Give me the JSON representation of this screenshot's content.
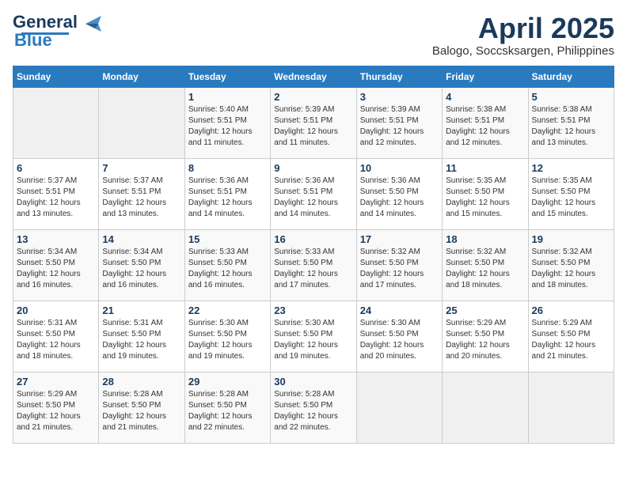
{
  "header": {
    "logo_line1": "General",
    "logo_line2": "Blue",
    "month_title": "April 2025",
    "subtitle": "Balogo, Soccsksargen, Philippines"
  },
  "days_of_week": [
    "Sunday",
    "Monday",
    "Tuesday",
    "Wednesday",
    "Thursday",
    "Friday",
    "Saturday"
  ],
  "weeks": [
    [
      {
        "day": "",
        "info": ""
      },
      {
        "day": "",
        "info": ""
      },
      {
        "day": "1",
        "info": "Sunrise: 5:40 AM\nSunset: 5:51 PM\nDaylight: 12 hours and 11 minutes."
      },
      {
        "day": "2",
        "info": "Sunrise: 5:39 AM\nSunset: 5:51 PM\nDaylight: 12 hours and 11 minutes."
      },
      {
        "day": "3",
        "info": "Sunrise: 5:39 AM\nSunset: 5:51 PM\nDaylight: 12 hours and 12 minutes."
      },
      {
        "day": "4",
        "info": "Sunrise: 5:38 AM\nSunset: 5:51 PM\nDaylight: 12 hours and 12 minutes."
      },
      {
        "day": "5",
        "info": "Sunrise: 5:38 AM\nSunset: 5:51 PM\nDaylight: 12 hours and 13 minutes."
      }
    ],
    [
      {
        "day": "6",
        "info": "Sunrise: 5:37 AM\nSunset: 5:51 PM\nDaylight: 12 hours and 13 minutes."
      },
      {
        "day": "7",
        "info": "Sunrise: 5:37 AM\nSunset: 5:51 PM\nDaylight: 12 hours and 13 minutes."
      },
      {
        "day": "8",
        "info": "Sunrise: 5:36 AM\nSunset: 5:51 PM\nDaylight: 12 hours and 14 minutes."
      },
      {
        "day": "9",
        "info": "Sunrise: 5:36 AM\nSunset: 5:51 PM\nDaylight: 12 hours and 14 minutes."
      },
      {
        "day": "10",
        "info": "Sunrise: 5:36 AM\nSunset: 5:50 PM\nDaylight: 12 hours and 14 minutes."
      },
      {
        "day": "11",
        "info": "Sunrise: 5:35 AM\nSunset: 5:50 PM\nDaylight: 12 hours and 15 minutes."
      },
      {
        "day": "12",
        "info": "Sunrise: 5:35 AM\nSunset: 5:50 PM\nDaylight: 12 hours and 15 minutes."
      }
    ],
    [
      {
        "day": "13",
        "info": "Sunrise: 5:34 AM\nSunset: 5:50 PM\nDaylight: 12 hours and 16 minutes."
      },
      {
        "day": "14",
        "info": "Sunrise: 5:34 AM\nSunset: 5:50 PM\nDaylight: 12 hours and 16 minutes."
      },
      {
        "day": "15",
        "info": "Sunrise: 5:33 AM\nSunset: 5:50 PM\nDaylight: 12 hours and 16 minutes."
      },
      {
        "day": "16",
        "info": "Sunrise: 5:33 AM\nSunset: 5:50 PM\nDaylight: 12 hours and 17 minutes."
      },
      {
        "day": "17",
        "info": "Sunrise: 5:32 AM\nSunset: 5:50 PM\nDaylight: 12 hours and 17 minutes."
      },
      {
        "day": "18",
        "info": "Sunrise: 5:32 AM\nSunset: 5:50 PM\nDaylight: 12 hours and 18 minutes."
      },
      {
        "day": "19",
        "info": "Sunrise: 5:32 AM\nSunset: 5:50 PM\nDaylight: 12 hours and 18 minutes."
      }
    ],
    [
      {
        "day": "20",
        "info": "Sunrise: 5:31 AM\nSunset: 5:50 PM\nDaylight: 12 hours and 18 minutes."
      },
      {
        "day": "21",
        "info": "Sunrise: 5:31 AM\nSunset: 5:50 PM\nDaylight: 12 hours and 19 minutes."
      },
      {
        "day": "22",
        "info": "Sunrise: 5:30 AM\nSunset: 5:50 PM\nDaylight: 12 hours and 19 minutes."
      },
      {
        "day": "23",
        "info": "Sunrise: 5:30 AM\nSunset: 5:50 PM\nDaylight: 12 hours and 19 minutes."
      },
      {
        "day": "24",
        "info": "Sunrise: 5:30 AM\nSunset: 5:50 PM\nDaylight: 12 hours and 20 minutes."
      },
      {
        "day": "25",
        "info": "Sunrise: 5:29 AM\nSunset: 5:50 PM\nDaylight: 12 hours and 20 minutes."
      },
      {
        "day": "26",
        "info": "Sunrise: 5:29 AM\nSunset: 5:50 PM\nDaylight: 12 hours and 21 minutes."
      }
    ],
    [
      {
        "day": "27",
        "info": "Sunrise: 5:29 AM\nSunset: 5:50 PM\nDaylight: 12 hours and 21 minutes."
      },
      {
        "day": "28",
        "info": "Sunrise: 5:28 AM\nSunset: 5:50 PM\nDaylight: 12 hours and 21 minutes."
      },
      {
        "day": "29",
        "info": "Sunrise: 5:28 AM\nSunset: 5:50 PM\nDaylight: 12 hours and 22 minutes."
      },
      {
        "day": "30",
        "info": "Sunrise: 5:28 AM\nSunset: 5:50 PM\nDaylight: 12 hours and 22 minutes."
      },
      {
        "day": "",
        "info": ""
      },
      {
        "day": "",
        "info": ""
      },
      {
        "day": "",
        "info": ""
      }
    ]
  ]
}
